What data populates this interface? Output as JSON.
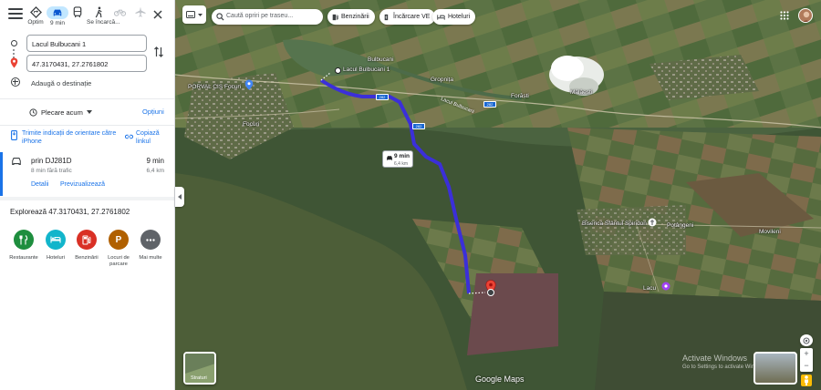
{
  "modes": {
    "best": "Optim",
    "drive_time": "9 min",
    "walk_state": "Se încarcă..."
  },
  "waypoints": {
    "origin": "Lacul Bulbucani 1",
    "destination": "47.3170431, 27.2761802"
  },
  "add_destination": "Adaugă o destinație",
  "depart": {
    "label": "Plecare acum",
    "options": "Opțiuni"
  },
  "send_to_phone": "Trimite indicații de orientare către iPhone",
  "copy_link": "Copiază linkul",
  "route": {
    "via": "prin DJ281D",
    "time": "9 min",
    "traffic": "8 min fără trafic",
    "distance": "6,4 km",
    "details": "Detalii",
    "preview": "Previzualizează"
  },
  "explore": {
    "title": "Explorează 47.3170431, 27.2761802",
    "categories": [
      {
        "label": "Restaurante",
        "icon": "restaurant-icon",
        "color": "#1e8e3e"
      },
      {
        "label": "Hoteluri",
        "icon": "hotel-icon",
        "color": "#12b5cb"
      },
      {
        "label": "Benzinării",
        "icon": "gas-station-icon",
        "color": "#d93025"
      },
      {
        "label": "Locuri de parcare",
        "icon": "parking-icon",
        "color": "#b06000"
      },
      {
        "label": "Mai multe",
        "icon": "more-icon",
        "color": "#5f6368"
      }
    ]
  },
  "map": {
    "search_placeholder": "Caută opriri pe traseu...",
    "chips": [
      "Benzinării",
      "Încărcare VE",
      "Hoteluri"
    ],
    "route_time": "9 min",
    "route_distance": "6,4 km",
    "labels": {
      "origin_pin": "Lacul Bulbucani 1",
      "bulbucani": "Bulbucani",
      "gropnita": "Gropnița",
      "forasti": "Forăști",
      "malaesti": "Mălăești",
      "focuri": "Focuri",
      "porval": "PORVAL CIS Focuri",
      "lacul_bulbucani": "Lacul Bulbucani",
      "biserica": "Biserica Sfântul Spiridon",
      "poteriesti": "Potângeni",
      "movileni": "Movileni",
      "lacu": "Lacu"
    },
    "road_shields": [
      "282",
      "282",
      "282"
    ],
    "satellite_label": "Straturi",
    "google": "Google Maps",
    "activate_title": "Activate Windows",
    "activate_sub": "Go to Settings to activate Windows.",
    "zoom_in": "+",
    "zoom_out": "−"
  },
  "colors": {
    "route": "#3b2fd9",
    "accent": "#1a73e8",
    "active_mode": "#c2e7ff"
  }
}
